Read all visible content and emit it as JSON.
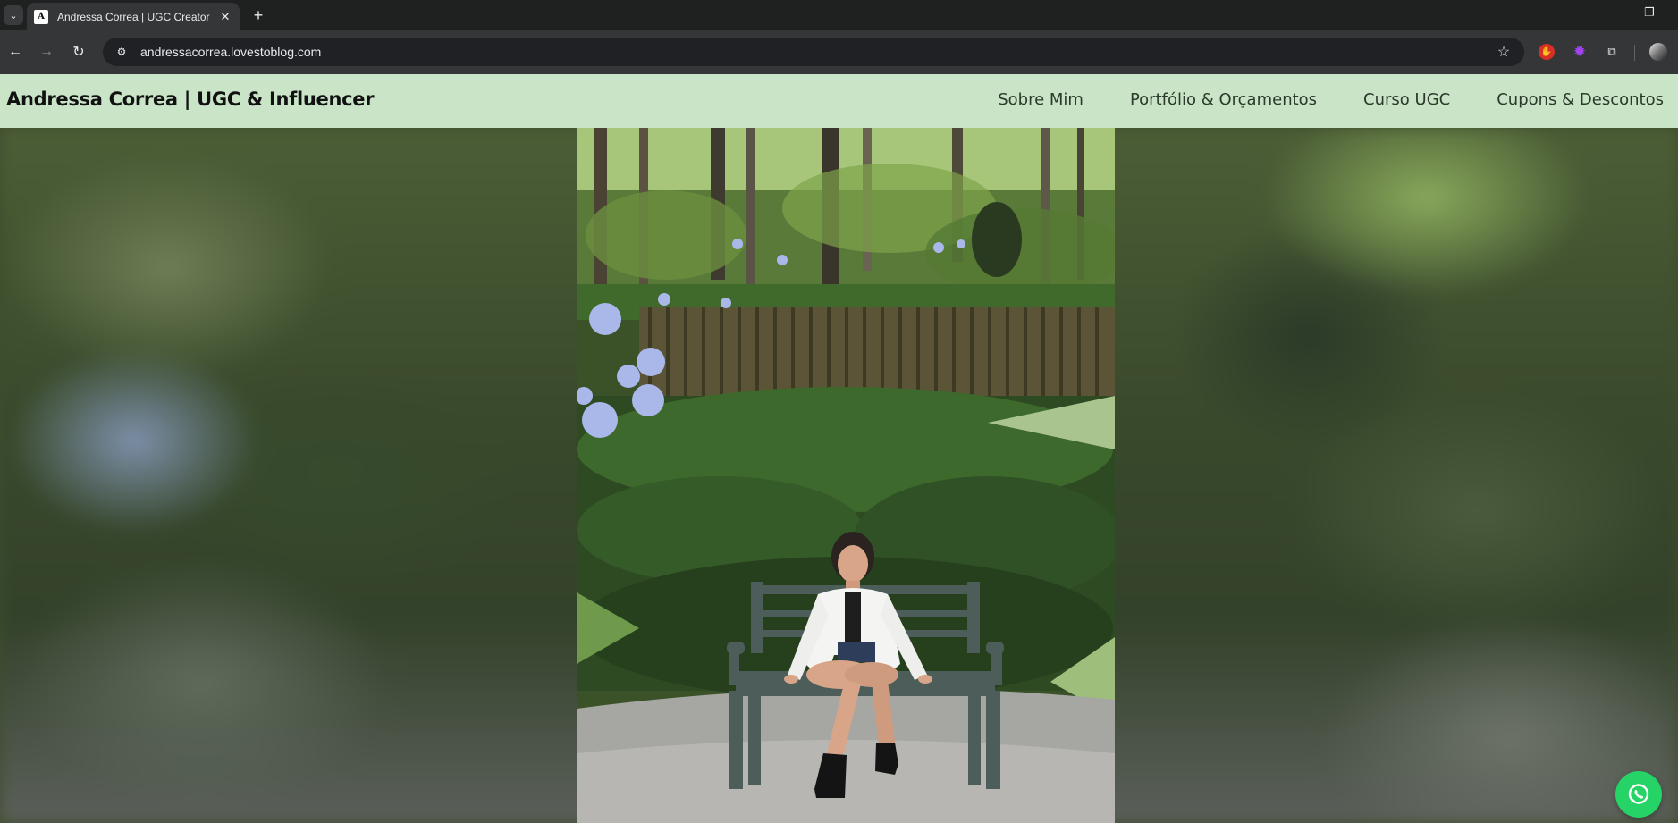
{
  "browser": {
    "tab_title": "Andressa Correa | UGC Creator",
    "url": "andressacorrea.lovestoblog.com"
  },
  "site": {
    "brand": "Andressa Correa | UGC & Influencer",
    "nav": [
      {
        "label": "Sobre Mim"
      },
      {
        "label": "Portfólio & Orçamentos"
      },
      {
        "label": "Curso UGC"
      },
      {
        "label": "Cupons & Descontos"
      }
    ]
  },
  "icons": {
    "tab_search": "chevron-down-icon",
    "close_tab": "close-icon",
    "new_tab": "plus-icon",
    "back": "arrow-left-icon",
    "forward": "arrow-right-icon",
    "reload": "reload-icon",
    "site_info": "tune-icon",
    "bookmark": "star-icon",
    "whatsapp": "whatsapp-icon"
  },
  "colors": {
    "header_bg": "#c9e4c6",
    "whatsapp": "#25d366"
  }
}
